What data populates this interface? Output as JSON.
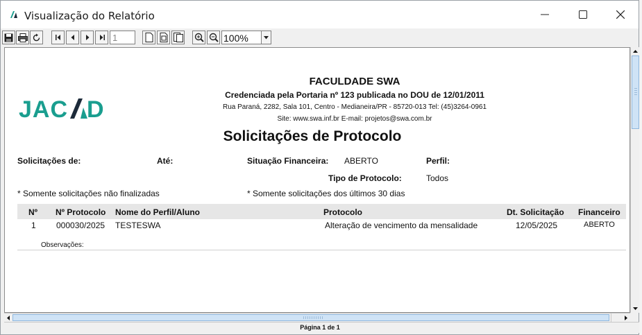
{
  "window": {
    "title": "Visualização do Relatório"
  },
  "toolbar": {
    "page_value": "1",
    "zoom_value": "100%"
  },
  "report": {
    "logo_text": "JACAD",
    "org_name": "FACULDADE SWA",
    "credential": "Credenciada pela Portaria nº 123 publicada no DOU de 12/01/2011",
    "address": "Rua Paraná, 2282, Sala 101, Centro - Medianeira/PR - 85720-013 Tel: (45)3264-0961",
    "site_line": "Site: www.swa.inf.br  E-mail: projetos@swa.com.br",
    "title": "Solicitações de Protocolo",
    "filters": {
      "solicitacoes_label": "Solicitações de:",
      "ate_label": "Até:",
      "situacao_label": "Situação Financeira:",
      "situacao_value": "ABERTO",
      "perfil_label": "Perfil:",
      "tipo_label": "Tipo de Protocolo:",
      "tipo_value": "Todos"
    },
    "notes": {
      "left": "* Somente solicitações não finalizadas",
      "right": "* Somente solicitações dos últimos 30 dias"
    },
    "columns": [
      "Nº",
      "Nº Protocolo",
      "Nome do Perfil/Aluno",
      "Protocolo",
      "Dt. Solicitação",
      "Financeiro"
    ],
    "rows": [
      [
        "1",
        "000030/2025",
        "TESTESWA",
        "Alteração de vencimento da mensalidade",
        "12/05/2025",
        "ABERTO"
      ]
    ],
    "obs_label": "Observações:"
  },
  "status": {
    "page_info": "Página 1 de 1"
  },
  "colors": {
    "logo_teal": "#1a9e8f",
    "logo_dark": "#1d2b3a",
    "scroll_thumb": "#cfe3f6"
  }
}
